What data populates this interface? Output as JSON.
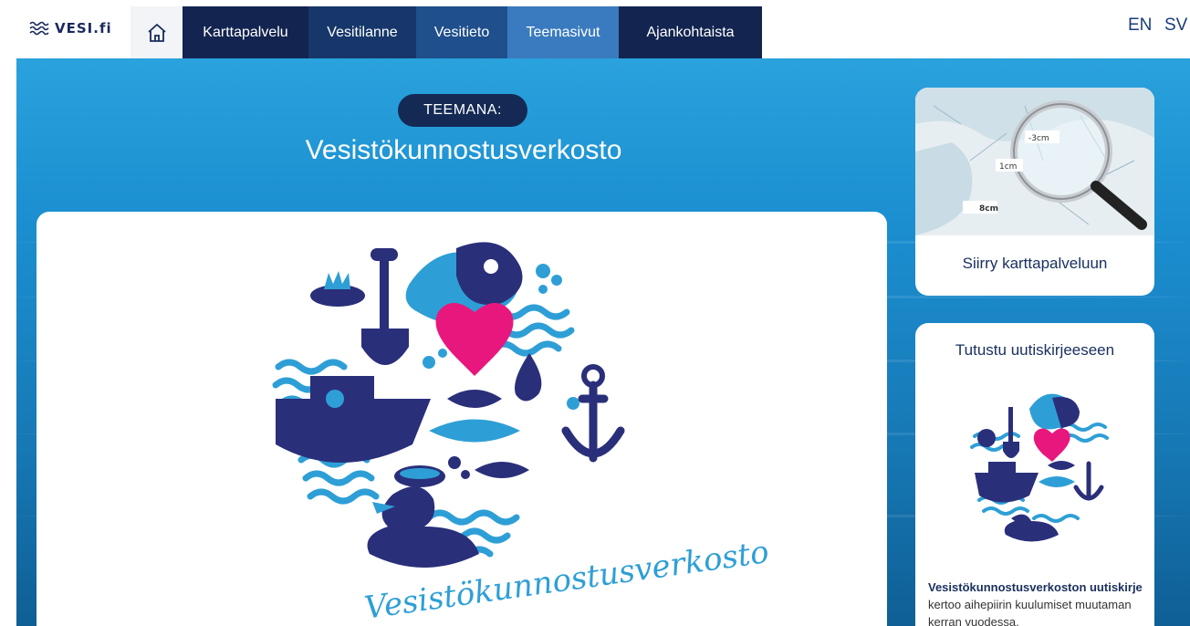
{
  "header": {
    "logo_text": "VESI.fi",
    "home_icon": "home-icon",
    "nav": [
      {
        "label": "Karttapalvelu",
        "color": "#12244f"
      },
      {
        "label": "Vesitilanne",
        "color": "#17376a"
      },
      {
        "label": "Vesitieto",
        "color": "#1f4f8c"
      },
      {
        "label": "Teemasivut",
        "color": "#3a7bbf"
      },
      {
        "label": "Ajankohtaista",
        "color": "#12244f"
      }
    ],
    "lang_en": "EN",
    "lang_sv": "SV"
  },
  "hero": {
    "badge": "TEEMANA:",
    "title": "Vesistökunnostusverkosto"
  },
  "main_card": {
    "logo_text": "Vesistökunnostusverkosto"
  },
  "map_card": {
    "cta": "Siirry karttapalveluun",
    "labels": [
      "-3cm",
      "1cm",
      "8cm"
    ]
  },
  "news_card": {
    "title": "Tutustu uutiskirjeeseen",
    "text_bold": "Vesistökunnostusverkoston uutiskirje",
    "text_rest": " kertoo aihepiirin kuulumiset muutaman kerran vuodessa."
  },
  "colors": {
    "navy": "#1a2a5e",
    "hero_blue": "#1b8fd0",
    "pink": "#e8177d",
    "teal": "#2e9fd6"
  }
}
